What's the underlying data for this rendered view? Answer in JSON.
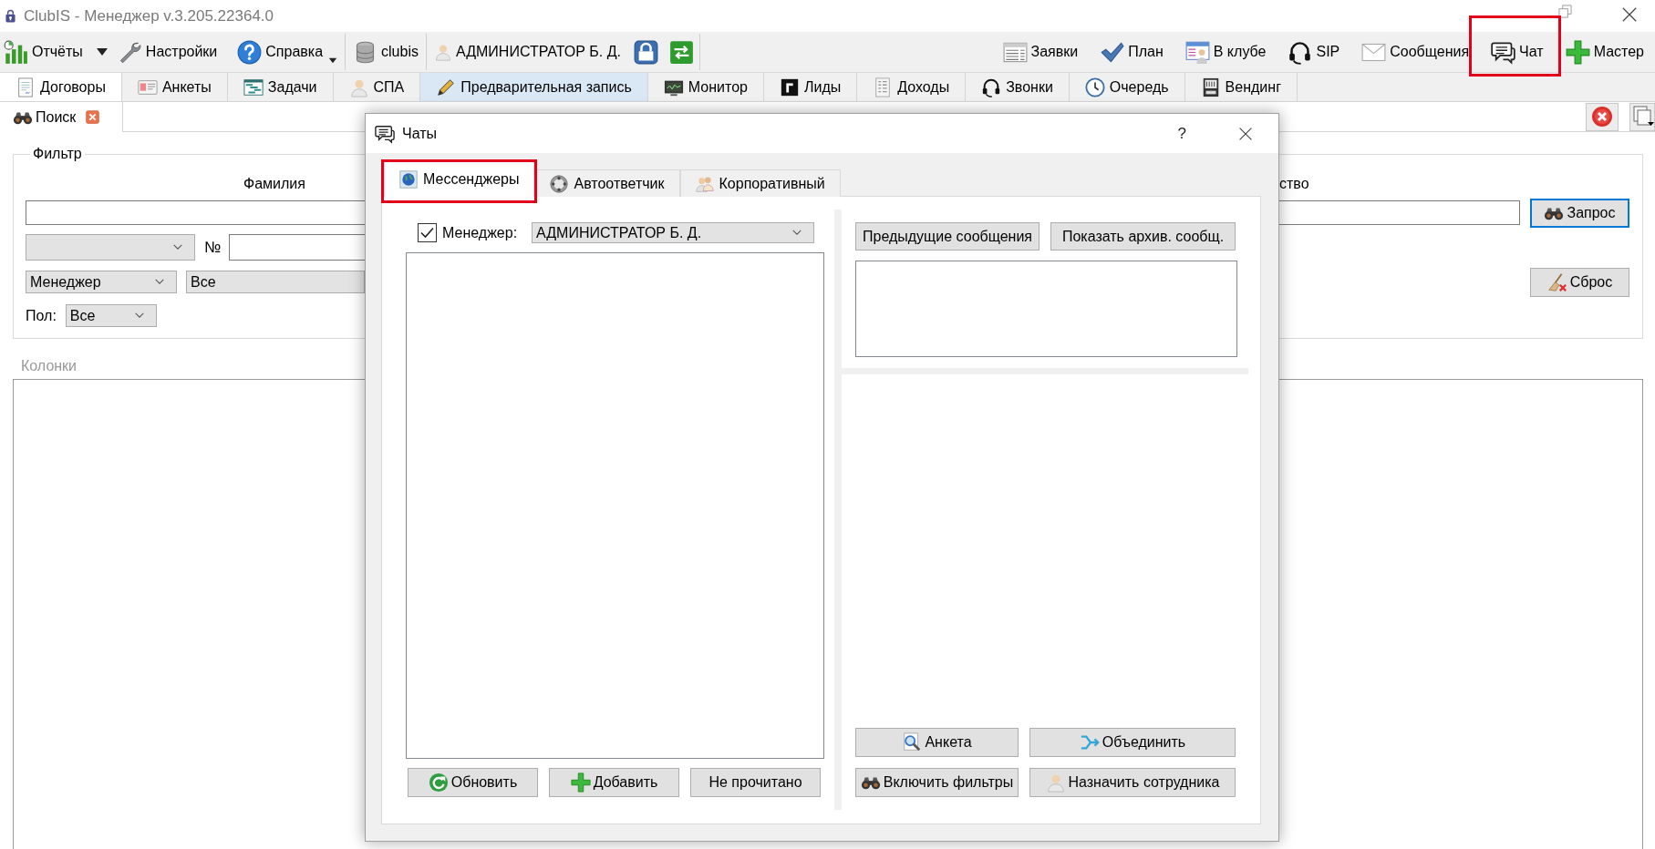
{
  "window": {
    "title": "ClubIS - Менеджер v.3.205.22364.0"
  },
  "toolbar": {
    "left_groups": [
      [
        {
          "kind": "split",
          "label": "Отчёты"
        },
        {
          "kind": "button",
          "label": "Настройки"
        },
        {
          "kind": "menu",
          "label": "Справка"
        }
      ],
      [
        {
          "kind": "button",
          "label": "clubis"
        }
      ],
      [
        {
          "kind": "button",
          "label": "АДМИНИСТРАТОР Б. Д."
        },
        {
          "kind": "icon"
        },
        {
          "kind": "icon"
        }
      ]
    ],
    "right": [
      {
        "label": "Заявки",
        "highlighted": false
      },
      {
        "label": "План",
        "highlighted": false
      },
      {
        "label": "В клубе",
        "highlighted": false
      },
      {
        "label": "SIP",
        "highlighted": false
      },
      {
        "label": "Сообщения",
        "highlighted": false
      },
      {
        "label": "Чат",
        "highlighted": true
      },
      {
        "label": "Мастер",
        "highlighted": false
      }
    ]
  },
  "main_tabs": [
    {
      "label": "Договоры",
      "selected": true,
      "hovered": false
    },
    {
      "label": "Анкеты",
      "selected": false,
      "hovered": false
    },
    {
      "label": "Задачи",
      "selected": false,
      "hovered": false
    },
    {
      "label": "СПА",
      "selected": false,
      "hovered": false
    },
    {
      "label": "Предварительная запись",
      "selected": false,
      "hovered": true
    },
    {
      "label": "Монитор",
      "selected": false,
      "hovered": false
    },
    {
      "label": "Лиды",
      "selected": false,
      "hovered": false
    },
    {
      "label": "Доходы",
      "selected": false,
      "hovered": false
    },
    {
      "label": "Звонки",
      "selected": false,
      "hovered": false
    },
    {
      "label": "Очередь",
      "selected": false,
      "hovered": false
    },
    {
      "label": "Вендинг",
      "selected": false,
      "hovered": false
    }
  ],
  "sub_tabs": [
    {
      "label": "Поиск",
      "selected": true,
      "closable": true
    }
  ],
  "filter": {
    "title": "Фильтр",
    "surname_label": "Фамилия",
    "number_label": "№",
    "manager_type": "Менеджер",
    "manager_value": "Все",
    "gender_label": "Пол:",
    "gender_value": "Все",
    "right_label": "ство",
    "buttons": [
      {
        "label": "Запрос",
        "focused": true
      },
      {
        "label": "Сброс",
        "focused": false
      }
    ]
  },
  "columns": {
    "title": "Колонки"
  },
  "dialog": {
    "title": "Чаты",
    "help": "?",
    "tabs": [
      {
        "label": "Мессенджеры",
        "selected": true,
        "highlighted": true
      },
      {
        "label": "Автоответчик",
        "selected": false,
        "highlighted": false
      },
      {
        "label": "Корпоративный",
        "selected": false,
        "highlighted": false
      }
    ],
    "manager_filter": {
      "label": "Менеджер:",
      "checked": true,
      "value": "АДМИНИСТРАТОР Б. Д."
    },
    "list_buttons": [
      {
        "label": "Обновить"
      },
      {
        "label": "Добавить"
      },
      {
        "label": "Не прочитано"
      }
    ],
    "history_buttons": [
      {
        "label": "Предыдущие сообщения"
      },
      {
        "label": "Показать архив. сообщ."
      }
    ],
    "action_buttons": [
      {
        "label": "Анкета"
      },
      {
        "label": "Объединить"
      },
      {
        "label": "Включить фильтры"
      },
      {
        "label": "Назначить сотрудника"
      }
    ]
  }
}
